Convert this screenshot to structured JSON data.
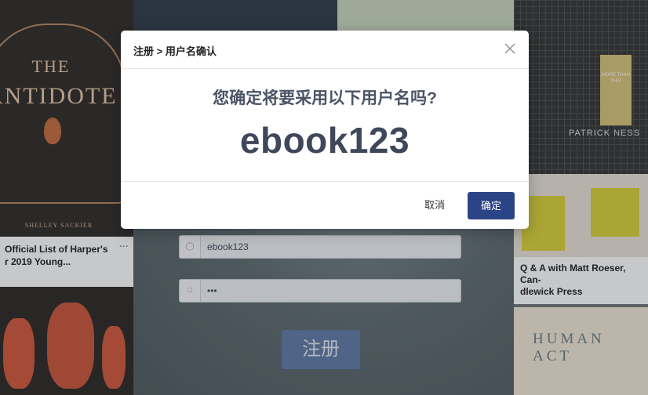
{
  "background": {
    "book1": {
      "title_the": "THE",
      "title_main": "ANTIDOTE",
      "author": "SHELLEY SACKIER"
    },
    "caption1": {
      "text": "Official List of Harper's\nr 2019 Young...",
      "line1": "Official List of Harper's",
      "line2": "r 2019 Young...",
      "more": "···"
    },
    "book2": {
      "cover_text": "MORE THAN THIS",
      "author": "PATRICK NESS"
    },
    "caption2": {
      "line1": "Q & A with Matt Roeser, Can-",
      "line2": "dlewick Press"
    },
    "book3": {
      "title": "HUMAN ACT"
    }
  },
  "register_form": {
    "username_value": "ebook123",
    "password_value": "•••",
    "username_icon": "user-icon",
    "password_icon": "lock-icon",
    "submit_label": "注册"
  },
  "modal": {
    "title": "注册 > 用户名确认",
    "question": "您确定将要采用以下用户名吗?",
    "username": "ebook123",
    "cancel_label": "取消",
    "confirm_label": "确定",
    "close_icon": "close-icon",
    "accent_color": "#2b4486"
  }
}
